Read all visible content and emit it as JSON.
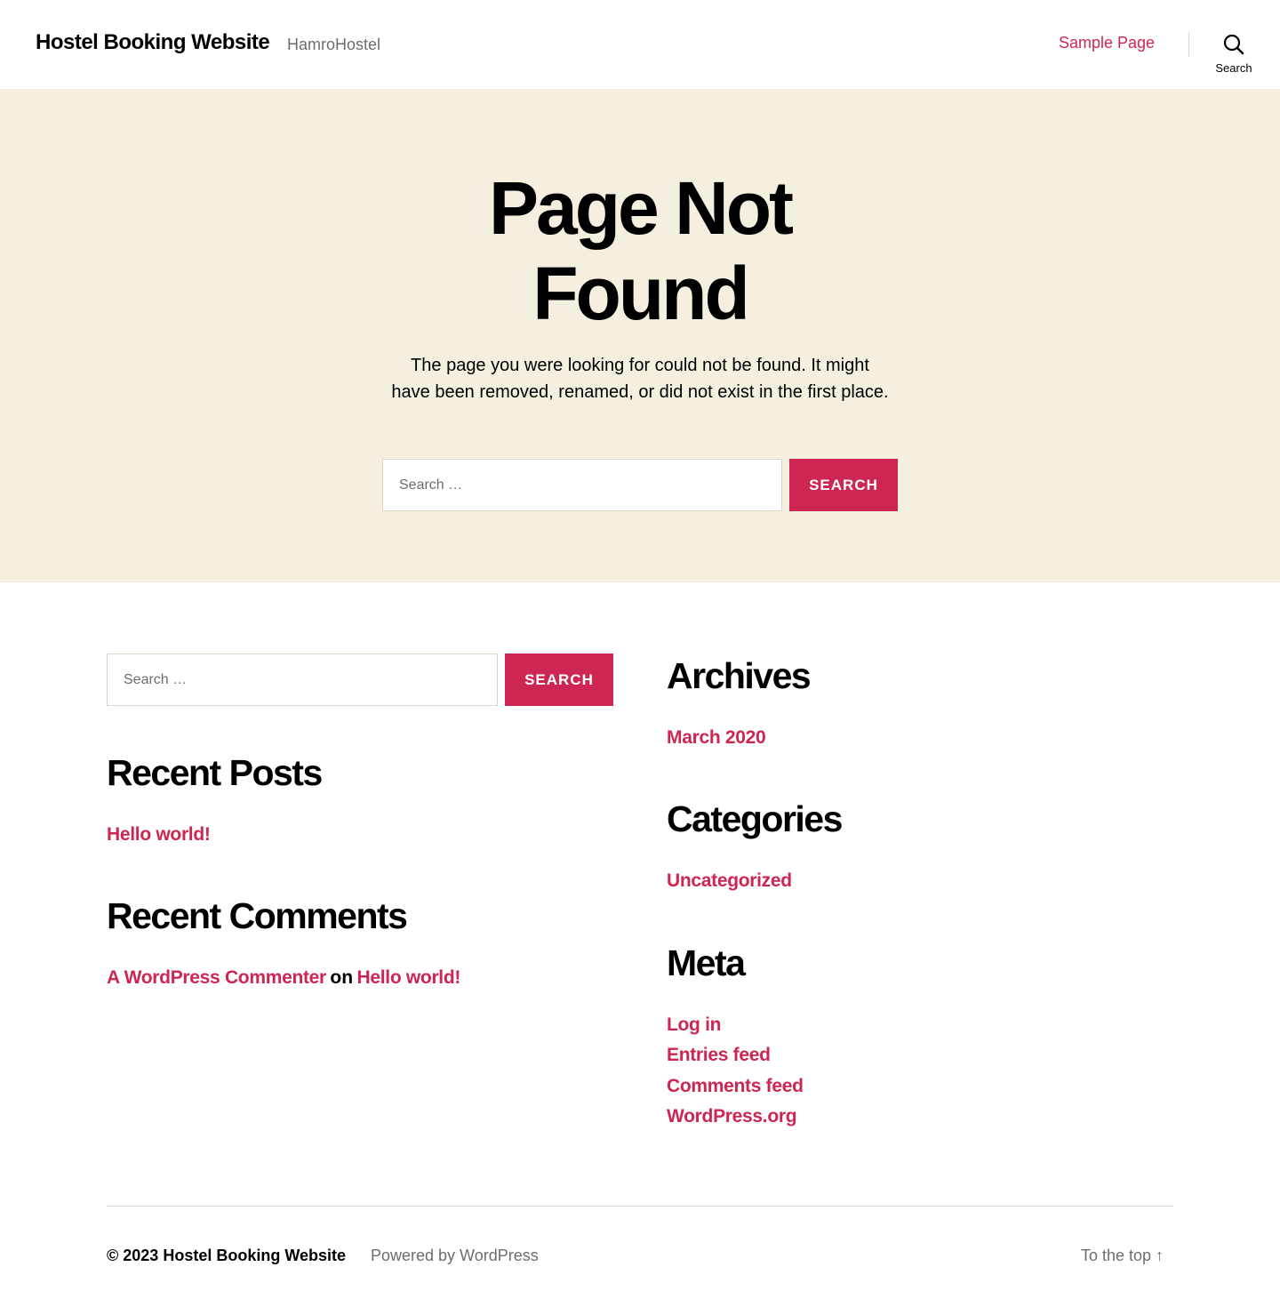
{
  "header": {
    "site_title": "Hostel Booking Website",
    "site_description": "HamroHostel",
    "nav_link": "Sample Page",
    "search_toggle_label": "Search"
  },
  "hero": {
    "title_line1": "Page Not",
    "title_line2": "Found",
    "message": "The page you were looking for could not be found. It might have been removed, renamed, or did not exist in the first place.",
    "search_placeholder": "Search …",
    "search_button": "Search"
  },
  "widgets": {
    "search_placeholder": "Search …",
    "search_button": "Search",
    "recent_posts": {
      "title": "Recent Posts",
      "items": [
        "Hello world!"
      ]
    },
    "recent_comments": {
      "title": "Recent Comments",
      "author": "A WordPress Commenter",
      "joiner": "on",
      "post": "Hello world!"
    },
    "archives": {
      "title": "Archives",
      "items": [
        "March 2020"
      ]
    },
    "categories": {
      "title": "Categories",
      "items": [
        "Uncategorized"
      ]
    },
    "meta": {
      "title": "Meta",
      "items": [
        "Log in",
        "Entries feed",
        "Comments feed",
        "WordPress.org"
      ]
    }
  },
  "footer": {
    "copyright": "© 2023",
    "site_link": "Hostel Booking Website",
    "powered_by": "Powered by WordPress",
    "to_top": "To the top ↑"
  },
  "colors": {
    "accent": "#cd2653",
    "hero_background": "#f5efe0",
    "secondary_text": "#6d6d6d",
    "border": "#dcd7ca"
  }
}
